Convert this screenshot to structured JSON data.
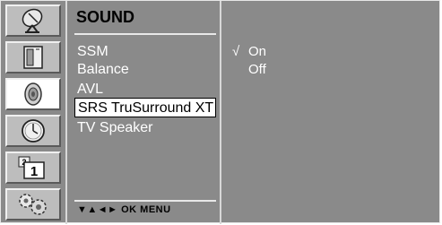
{
  "icons": [
    {
      "name": "satellite-dish-icon",
      "active": false
    },
    {
      "name": "picture-icon",
      "active": false
    },
    {
      "name": "speaker-icon",
      "active": true
    },
    {
      "name": "clock-icon",
      "active": false
    },
    {
      "name": "channel-1-icon",
      "label": "1",
      "small_label": "2"
    },
    {
      "name": "gears-icon",
      "active": false
    }
  ],
  "menu": {
    "title": "SOUND",
    "items": [
      "SSM",
      "Balance",
      "AVL",
      "SRS TruSurround XT",
      "TV Speaker"
    ],
    "selected_index": 3,
    "nav_hint": "▼▲◄► OK MENU"
  },
  "submenu": {
    "options": [
      {
        "label": "On",
        "checked": true,
        "check_mark": "√"
      },
      {
        "label": "Off",
        "checked": false,
        "check_mark": ""
      }
    ]
  },
  "colors": {
    "panel": "#8a8a8a",
    "icon_button": "#bdbdbd",
    "active_button": "#ffffff",
    "text": "#ffffff"
  }
}
